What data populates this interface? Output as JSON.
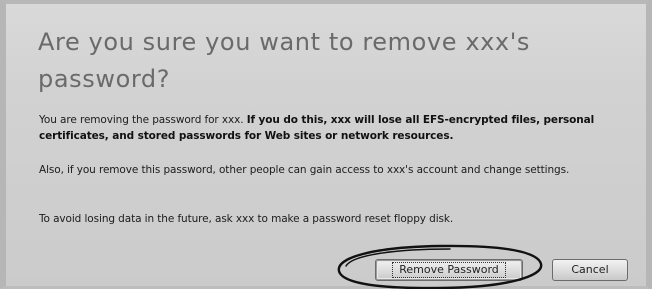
{
  "dialog": {
    "title": "Are you sure you want to remove xxx's password?",
    "paragraph1": {
      "normal": "You are removing the password for xxx.",
      "bold": "If you do this, xxx will lose all EFS-encrypted files, personal certificates, and stored passwords for Web sites or network resources."
    },
    "paragraph2": "Also, if you remove this password, other people can gain access to xxx's account and change settings.",
    "paragraph3": "To avoid losing data in the future, ask xxx to make a password reset floppy disk.",
    "buttons": {
      "remove": "Remove Password",
      "cancel": "Cancel"
    }
  }
}
